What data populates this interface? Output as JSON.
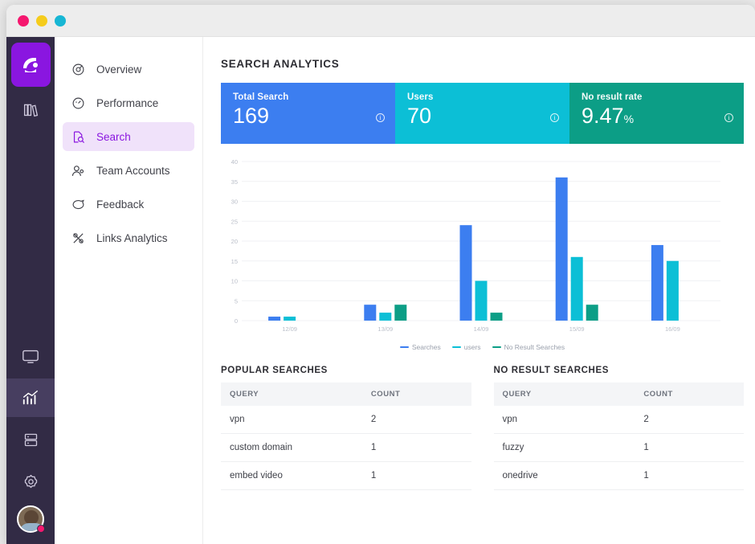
{
  "window": {
    "traffic_lights": [
      "close",
      "minimize",
      "maximize"
    ]
  },
  "rail": {
    "logo_icon": "brand-logo-icon",
    "items": [
      {
        "icon": "books-icon",
        "name": "library",
        "active": false
      },
      {
        "icon": "monitor-icon",
        "name": "monitor",
        "active": false
      },
      {
        "icon": "bar-chart-icon",
        "name": "analytics",
        "active": true
      },
      {
        "icon": "server-icon",
        "name": "server",
        "active": false
      },
      {
        "icon": "gear-icon",
        "name": "settings",
        "active": false
      }
    ],
    "avatar": {
      "name": "user-avatar",
      "badge": true
    }
  },
  "nav": {
    "items": [
      {
        "label": "Overview",
        "icon": "dashboard-icon",
        "active": false
      },
      {
        "label": "Performance",
        "icon": "gauge-icon",
        "active": false
      },
      {
        "label": "Search",
        "icon": "document-search-icon",
        "active": true
      },
      {
        "label": "Team Accounts",
        "icon": "people-icon",
        "active": false
      },
      {
        "label": "Feedback",
        "icon": "chat-icon",
        "active": false
      },
      {
        "label": "Links Analytics",
        "icon": "links-icon",
        "active": false
      }
    ]
  },
  "header": {
    "title": "SEARCH ANALYTICS"
  },
  "stats": [
    {
      "label": "Total Search",
      "value": "169",
      "unit": "",
      "color": "#3c7ef0",
      "info": "i"
    },
    {
      "label": "Users",
      "value": "70",
      "unit": "",
      "color": "#0cbfd6",
      "info": "i"
    },
    {
      "label": "No result rate",
      "value": "9.47",
      "unit": "%",
      "color": "#0c9e86",
      "info": "i"
    }
  ],
  "chart_data": {
    "type": "bar",
    "title": "",
    "xlabel": "",
    "ylabel": "",
    "categories": [
      "12/09",
      "13/09",
      "14/09",
      "15/09",
      "16/09"
    ],
    "series": [
      {
        "name": "Searches",
        "color": "#3c7ef0",
        "values": [
          1,
          4,
          24,
          36,
          19
        ]
      },
      {
        "name": "users",
        "color": "#0cbfd6",
        "values": [
          1,
          2,
          10,
          16,
          15
        ]
      },
      {
        "name": "No Result Searches",
        "color": "#0c9e86",
        "values": [
          0,
          4,
          2,
          4,
          0
        ]
      }
    ],
    "ylim": [
      0,
      40
    ],
    "yticks": [
      0,
      5,
      10,
      15,
      20,
      25,
      30,
      35,
      40
    ],
    "grid": true,
    "legend_position": "bottom"
  },
  "tables": [
    {
      "title": "POPULAR SEARCHES",
      "columns": [
        "QUERY",
        "COUNT"
      ],
      "rows": [
        {
          "query": "vpn",
          "count": "2"
        },
        {
          "query": "custom domain",
          "count": "1"
        },
        {
          "query": "embed video",
          "count": "1"
        }
      ]
    },
    {
      "title": "NO RESULT SEARCHES",
      "columns": [
        "QUERY",
        "COUNT"
      ],
      "rows": [
        {
          "query": "vpn",
          "count": "2"
        },
        {
          "query": "fuzzy",
          "count": "1"
        },
        {
          "query": "onedrive",
          "count": "1"
        }
      ]
    }
  ]
}
